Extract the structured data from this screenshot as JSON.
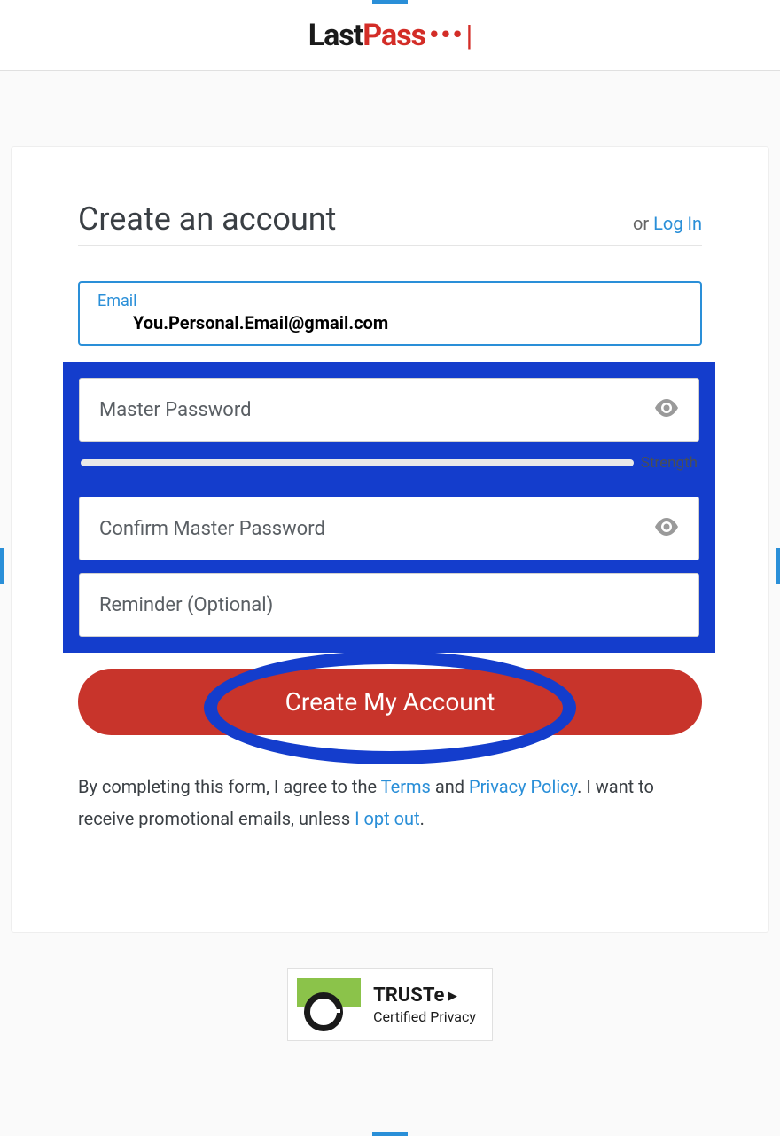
{
  "logo": {
    "part1": "Last",
    "part2": "Pass",
    "dots": "•••",
    "cursor": "|"
  },
  "header": {
    "title": "Create an account",
    "or_text": "or ",
    "login_link": "Log In"
  },
  "form": {
    "email": {
      "label": "Email",
      "value": "You.Personal.Email@gmail.com"
    },
    "master_password": {
      "placeholder": "Master Password"
    },
    "strength_label": "Strength",
    "confirm_password": {
      "placeholder": "Confirm Master Password"
    },
    "reminder": {
      "placeholder": "Reminder (Optional)"
    },
    "submit_label": "Create My Account"
  },
  "agreement": {
    "part1": "By completing this form, I agree to the ",
    "terms_link": "Terms",
    "part2": " and ",
    "privacy_link": "Privacy Policy",
    "part3": ". I want to receive promotional emails, unless ",
    "optout_link": "I opt out",
    "part4": "."
  },
  "truste": {
    "brand": "TRUSTe",
    "subtitle": "Certified Privacy"
  }
}
